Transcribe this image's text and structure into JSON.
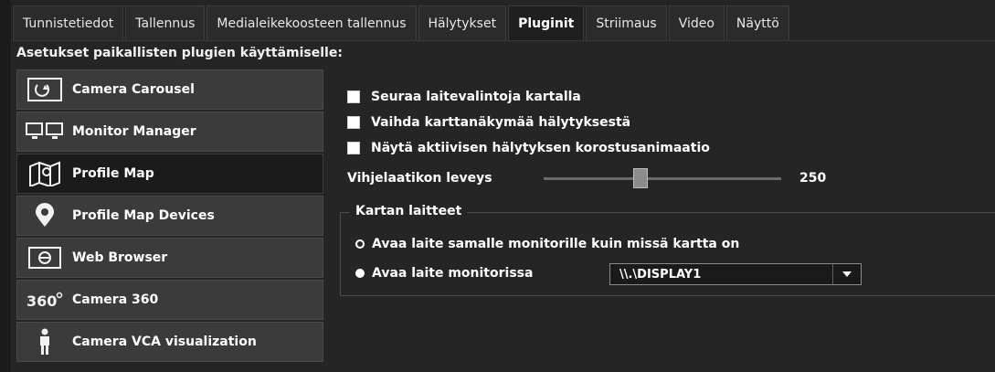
{
  "tabs": [
    {
      "label": "Tunnistetiedot",
      "active": false
    },
    {
      "label": "Tallennus",
      "active": false
    },
    {
      "label": "Medialeikekoosteen tallennus",
      "active": false
    },
    {
      "label": "Hälytykset",
      "active": false
    },
    {
      "label": "Pluginit",
      "active": true
    },
    {
      "label": "Striimaus",
      "active": false
    },
    {
      "label": "Video",
      "active": false
    },
    {
      "label": "Näyttö",
      "active": false
    }
  ],
  "section_title": "Asetukset paikallisten plugien käyttämiselle:",
  "plugins": [
    {
      "label": "Camera Carousel",
      "icon": "camera-carousel-icon",
      "selected": false
    },
    {
      "label": "Monitor Manager",
      "icon": "monitor-manager-icon",
      "selected": false
    },
    {
      "label": "Profile Map",
      "icon": "profile-map-icon",
      "selected": true
    },
    {
      "label": "Profile Map Devices",
      "icon": "map-pin-icon",
      "selected": false
    },
    {
      "label": "Web Browser",
      "icon": "web-browser-icon",
      "selected": false
    },
    {
      "label": "Camera 360",
      "icon": "camera-360-icon",
      "selected": false
    },
    {
      "label": "Camera VCA visualization",
      "icon": "person-icon",
      "selected": false
    }
  ],
  "settings": {
    "checkboxes": [
      {
        "label": "Seuraa laitevalintoja kartalla",
        "checked": true
      },
      {
        "label": "Vaihda karttanäkymää hälytyksestä",
        "checked": true
      },
      {
        "label": "Näytä aktiivisen hälytyksen korostusanimaatio",
        "checked": true
      }
    ],
    "slider_label": "Vihjelaatikon leveys",
    "slider_value": "250",
    "slider_fraction": 0.4
  },
  "group": {
    "title": "Kartan laitteet",
    "options": [
      {
        "label": "Avaa laite samalle monitorille kuin missä kartta on",
        "selected": false
      },
      {
        "label": "Avaa laite monitorissa",
        "selected": true
      }
    ],
    "monitor_value": "\\\\.\\DISPLAY1"
  }
}
